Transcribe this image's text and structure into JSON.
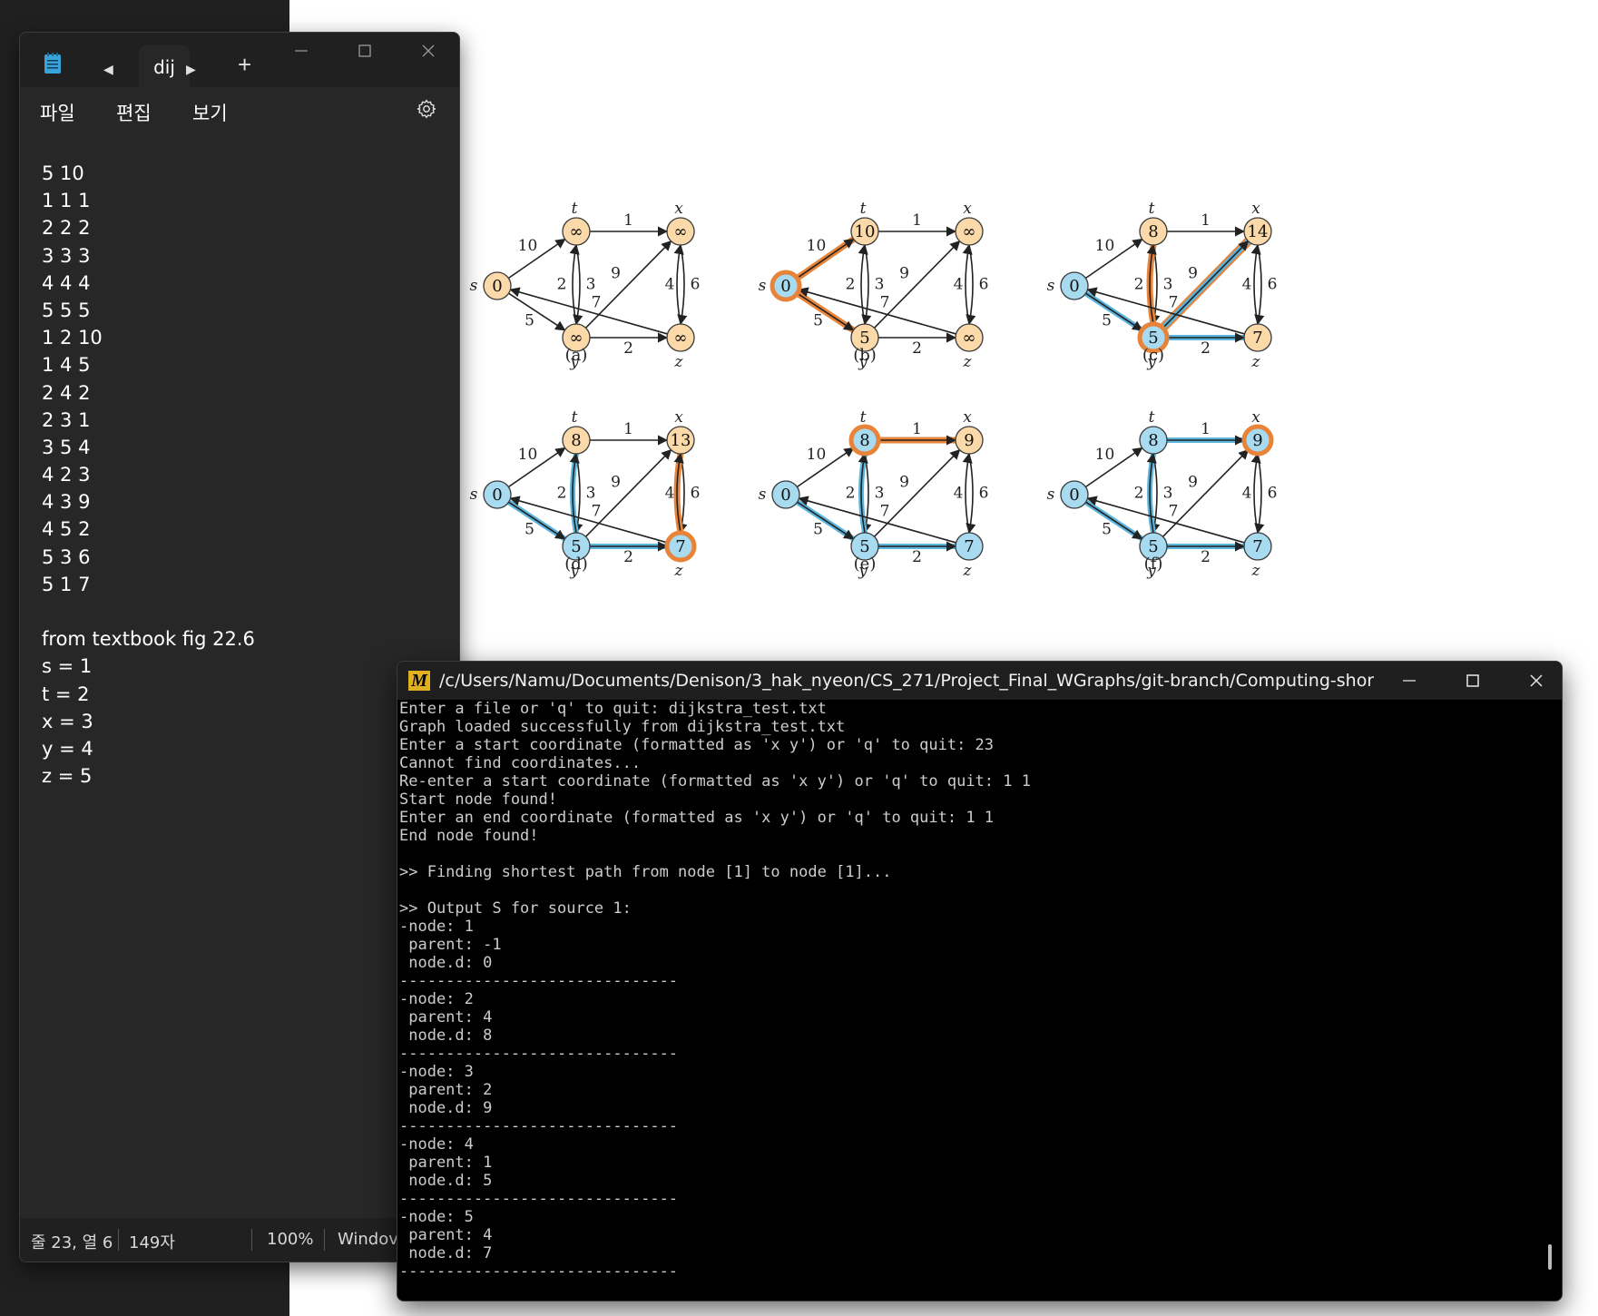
{
  "notepad": {
    "tab_label": "dij",
    "menu": [
      "파일",
      "편집",
      "보기"
    ],
    "lines": [
      "5 10",
      "1 1 1",
      "2 2 2",
      "3 3 3",
      "4 4 4",
      "5 5 5",
      "1 2 10",
      "1 4 5",
      "2 4 2",
      "2 3 1",
      "3 5 4",
      "4 2 3",
      "4 3 9",
      "4 5 2",
      "5 3 6",
      "5 1 7",
      "",
      "from textbook fig 22.6",
      "s = 1",
      "t = 2",
      "x = 3",
      "y = 4",
      "z = 5"
    ],
    "status": {
      "position": "줄 23, 열 6",
      "chars": "149자",
      "zoom": "100%",
      "line_ending": "Windov"
    }
  },
  "figure": {
    "vertex_labels": [
      "s",
      "t",
      "x",
      "y",
      "z"
    ],
    "subfigures": [
      {
        "caption": "(a)",
        "values": {
          "s": "0",
          "t": "∞",
          "x": "∞",
          "y": "∞",
          "z": "∞"
        }
      },
      {
        "caption": "(b)",
        "values": {
          "s": "0",
          "t": "10",
          "x": "∞",
          "y": "5",
          "z": "∞"
        }
      },
      {
        "caption": "(c)",
        "values": {
          "s": "0",
          "t": "8",
          "x": "14",
          "y": "5",
          "z": "7"
        }
      },
      {
        "caption": "(d)",
        "values": {
          "s": "0",
          "t": "8",
          "x": "13",
          "y": "5",
          "z": "7"
        }
      },
      {
        "caption": "(e)",
        "values": {
          "s": "0",
          "t": "8",
          "x": "9",
          "y": "5",
          "z": "7"
        }
      },
      {
        "caption": "(f)",
        "values": {
          "s": "0",
          "t": "8",
          "x": "9",
          "y": "5",
          "z": "7"
        }
      }
    ],
    "edge_weights": {
      "s_t": "10",
      "s_y": "5",
      "t_x": "1",
      "t_y": "2",
      "y_t": "3",
      "x_z": "4",
      "z_x": "6",
      "y_x": "9",
      "y_z": "2",
      "z_s": "7"
    },
    "colors": {
      "unvisited_fill": "#fbd9a8",
      "visited_fill": "#a8daf0",
      "stroke": "#3a3a3a",
      "highlight_orange": "#e8833a",
      "highlight_blue": "#5bb5dc"
    }
  },
  "terminal": {
    "title": "/c/Users/Namu/Documents/Denison/3_hak_nyeon/CS_271/Project_Final_WGraphs/git-branch/Computing-shortest-paths-with-...",
    "lines": [
      "Enter a file or 'q' to quit: dijkstra_test.txt",
      "Graph loaded successfully from dijkstra_test.txt",
      "Enter a start coordinate (formatted as 'x y') or 'q' to quit: 23",
      "Cannot find coordinates...",
      "Re-enter a start coordinate (formatted as 'x y') or 'q' to quit: 1 1",
      "Start node found!",
      "Enter an end coordinate (formatted as 'x y') or 'q' to quit: 1 1",
      "End node found!",
      "",
      ">> Finding shortest path from node [1] to node [1]...",
      "",
      ">> Output S for source 1:",
      "-node: 1",
      " parent: -1",
      " node.d: 0",
      "------------------------------",
      "-node: 2",
      " parent: 4",
      " node.d: 8",
      "------------------------------",
      "-node: 3",
      " parent: 2",
      " node.d: 9",
      "------------------------------",
      "-node: 4",
      " parent: 1",
      " node.d: 5",
      "------------------------------",
      "-node: 5",
      " parent: 4",
      " node.d: 7",
      "------------------------------"
    ]
  }
}
